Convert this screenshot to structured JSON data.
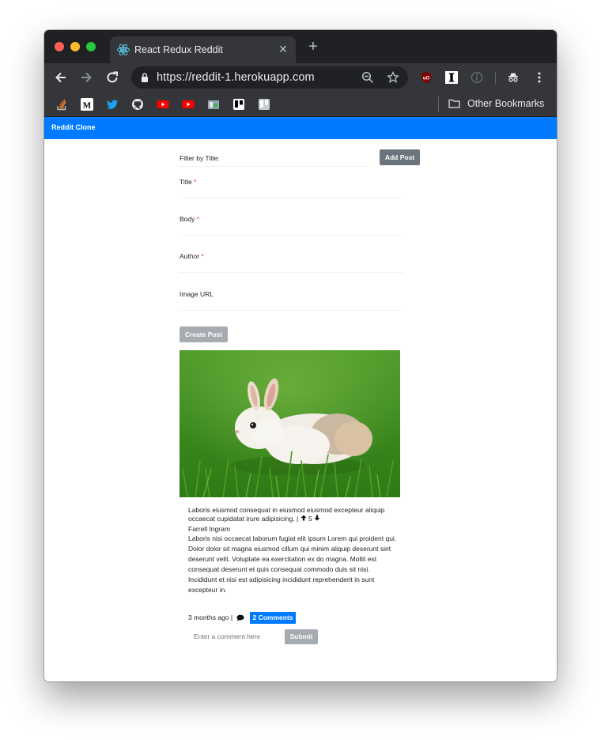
{
  "browser": {
    "tab_title": "React Redux Reddit",
    "url": "https://reddit-1.herokuapp.com",
    "other_bookmarks_label": "Other Bookmarks"
  },
  "app": {
    "brand": "Reddit Clone",
    "filter_label": "Filter by Title:",
    "add_post_label": "Add Post"
  },
  "form": {
    "title_label": "Title",
    "body_label": "Body",
    "author_label": "Author",
    "image_url_label": "Image URL",
    "required_mark": "*",
    "create_post_label": "Create Post"
  },
  "post": {
    "title": "Laboris eiusmod consequat in eiusmod eiusmod excepteur aliquip occaecat cupidatat irure adipisicing.",
    "separator": "|",
    "votes": "5",
    "author": "Farrell Ingram",
    "body": "Laboris nisi occaecat laborum fugiat elit ipsum Lorem qui proident qui. Dolor dolor sit magna eiusmod cillum qui minim aliquip deserunt sint deserunt velit. Voluptate ea exercitation ex do magna. Mollit est consequat deserunt et quis consequat commodo duis sit nisi. Incididunt et nisi est adipisicing incididunt reprehenderit in sunt excepteur in.",
    "time_ago": "3 months ago |",
    "comments_label": "2 Comments",
    "comment_placeholder": "Enter a comment here",
    "submit_label": "Submit"
  },
  "colors": {
    "navbar": "#007bff",
    "add_post_button": "#6c757d",
    "disabled_button": "#a5abb1",
    "required": "#dc3545"
  }
}
